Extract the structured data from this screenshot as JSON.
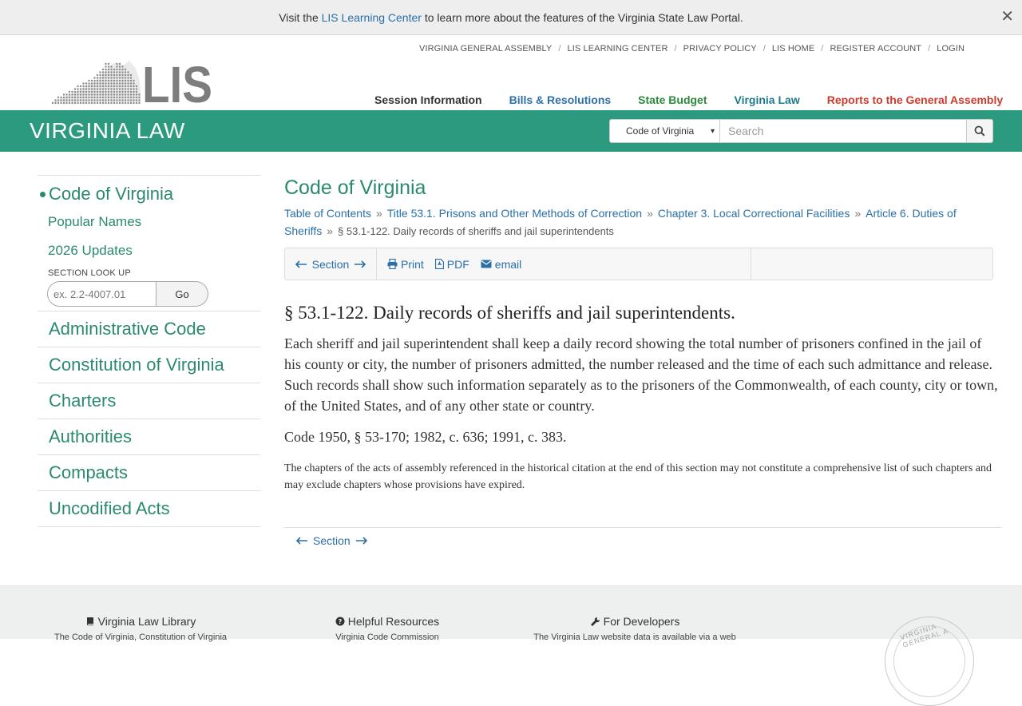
{
  "notice": {
    "prefix": "Visit the ",
    "link": "LIS Learning Center",
    "suffix": " to learn more about the features of the Virginia State Law Portal.",
    "close": "✕"
  },
  "utility_links": [
    "VIRGINIA GENERAL ASSEMBLY",
    "LIS LEARNING CENTER",
    "PRIVACY POLICY",
    "LIS HOME",
    "REGISTER ACCOUNT",
    "LOGIN"
  ],
  "logo": {
    "text": "LIS"
  },
  "main_nav": [
    "Session Information",
    "Bills & Resolutions",
    "State Budget",
    "Virginia Law",
    "Reports to the General Assembly"
  ],
  "band": {
    "title": "VIRGINIA LAW",
    "search_scope": "Code of Virginia",
    "search_placeholder": "Search"
  },
  "sidebar": {
    "active": "Code of Virginia",
    "sub_items": [
      "Popular Names",
      "2026 Updates"
    ],
    "lookup_label": "SECTION LOOK UP",
    "lookup_placeholder": "ex. 2.2-4007.01",
    "lookup_button": "Go",
    "items": [
      "Administrative Code",
      "Constitution of Virginia",
      "Charters",
      "Authorities",
      "Compacts",
      "Uncodified Acts"
    ]
  },
  "main": {
    "title": "Code of Virginia",
    "breadcrumbs": [
      "Table of Contents",
      "Title 53.1. Prisons and Other Methods of Correction",
      "Chapter 3. Local Correctional Facilities",
      "Article 6. Duties of Sheriffs"
    ],
    "breadcrumb_current": "§ 53.1-122. Daily records of sheriffs and jail superintendents",
    "breadcrumb_sep": "»",
    "toolbar": {
      "section": "Section",
      "print": "Print",
      "pdf": "PDF",
      "email": "email"
    },
    "heading": "§ 53.1-122. Daily records of sheriffs and jail superintendents.",
    "body": "Each sheriff and jail superintendent shall keep a daily record showing the total number of prisoners confined in the jail of his county or city, the number of prisoners admitted, the number released and the time of each such admittance and release. Such records shall show such information separately as to the prisoners of the Commonwealth, of each county, city or town, of the United States, and of any other state or country.",
    "history": "Code 1950, § 53-170; 1982, c. 636; 1991, c. 383.",
    "note": "The chapters of the acts of assembly referenced in the historical citation at the end of this section may not constitute a comprehensive list of such chapters and may exclude chapters whose provisions have expired.",
    "bottom_section": "Section"
  },
  "footer": {
    "col1_title": "Virginia Law Library",
    "col1_sub": "The Code of Virginia, Constitution of Virginia",
    "col2_title": "Helpful Resources",
    "col2_sub": "Virginia Code Commission",
    "col3_title": "For Developers",
    "col3_sub": "The Virginia Law website data is available via a web",
    "seal_text": "VIRGINIA GENERAL A"
  },
  "colors": {
    "teal": "#2b9a7e",
    "link_blue": "#2a6fa8",
    "green_text": "#2b8a6e",
    "nav_red": "#cc3b2b"
  }
}
